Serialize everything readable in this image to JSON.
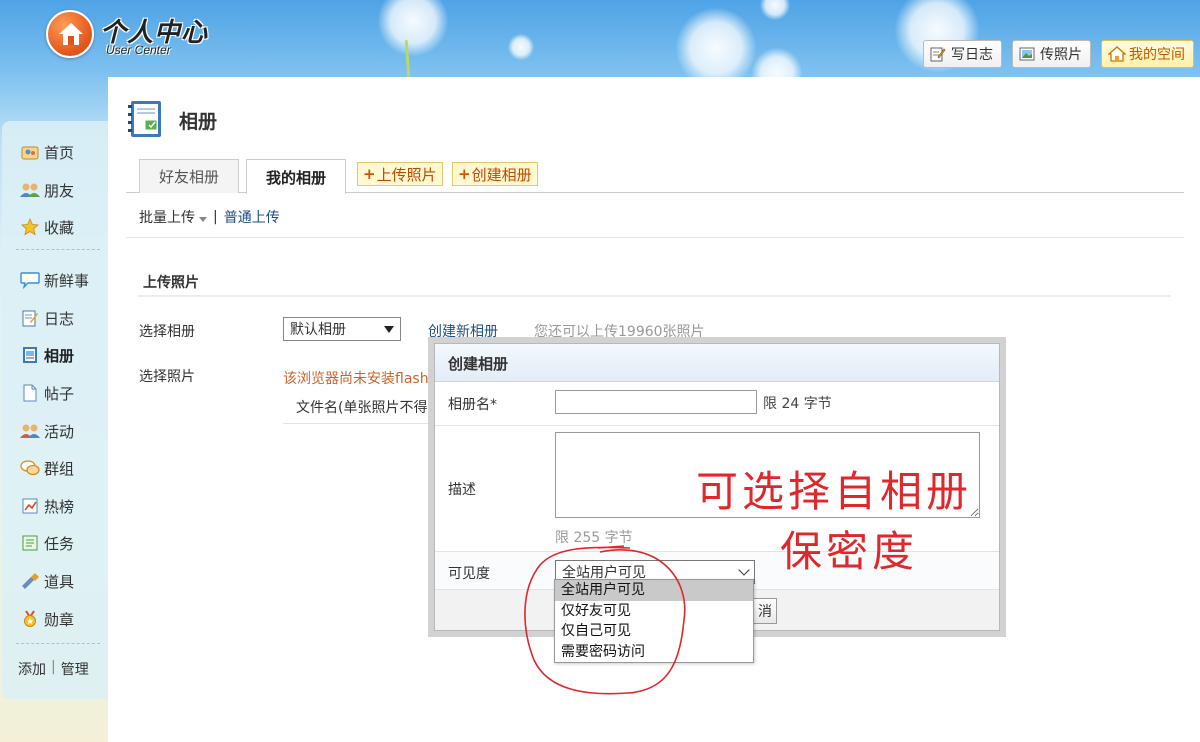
{
  "header": {
    "logo_title": "个人中心",
    "logo_subtitle": "User Center",
    "actions": [
      {
        "label": "写日志",
        "icon": "pencil-note-icon"
      },
      {
        "label": "传照片",
        "icon": "photo-icon"
      },
      {
        "label": "我的空间",
        "icon": "home-icon"
      }
    ]
  },
  "sidebar": {
    "items": [
      {
        "label": "首页",
        "icon": "home-people-icon"
      },
      {
        "label": "朋友",
        "icon": "friends-icon"
      },
      {
        "label": "收藏",
        "icon": "star-icon"
      },
      {
        "label": "新鲜事",
        "icon": "speech-bubble-icon"
      },
      {
        "label": "日志",
        "icon": "notebook-icon"
      },
      {
        "label": "相册",
        "icon": "album-icon",
        "active": true
      },
      {
        "label": "帖子",
        "icon": "document-icon"
      },
      {
        "label": "活动",
        "icon": "people-activity-icon"
      },
      {
        "label": "群组",
        "icon": "chat-group-icon"
      },
      {
        "label": "热榜",
        "icon": "hot-list-icon"
      },
      {
        "label": "任务",
        "icon": "task-icon"
      },
      {
        "label": "道具",
        "icon": "tool-icon"
      },
      {
        "label": "勋章",
        "icon": "medal-icon"
      }
    ],
    "footer_add": "添加",
    "footer_sep": "|",
    "footer_manage": "管理"
  },
  "page": {
    "title": "相册",
    "tabs": [
      {
        "label": "好友相册",
        "active": false
      },
      {
        "label": "我的相册",
        "active": true
      }
    ],
    "tab_actions": [
      {
        "plus": "+",
        "label": "上传照片"
      },
      {
        "plus": "+",
        "label": "创建相册"
      }
    ],
    "subnav": {
      "batch_upload": "批量上传",
      "sep": "|",
      "normal_upload": "普通上传"
    },
    "section_title": "上传照片",
    "select_album_label": "选择相册",
    "album_selected": "默认相册",
    "create_new_album": "创建新相册",
    "quota_text": "您还可以上传19960张照片",
    "select_photo_label": "选择照片",
    "flash_warning": "该浏览器尚未安装flash",
    "file_name_header": "文件名(单张照片不得"
  },
  "dialog": {
    "title": "创建相册",
    "name_label": "相册名*",
    "name_value": "",
    "name_limit": "限 24 字节",
    "desc_label": "描述",
    "desc_value": "",
    "desc_limit": "限 255 字节",
    "visibility_label": "可见度",
    "visibility_selected": "全站用户可见",
    "visibility_options": [
      "全站用户可见",
      "仅好友可见",
      "仅自己可见",
      "需要密码访问"
    ],
    "cancel_button_partial": "消"
  },
  "annotation": {
    "line1": "可选择自相册",
    "line2": "保密度",
    "color": "#e0272b"
  },
  "colors": {
    "link": "#1f4f82",
    "warning": "#c8652a",
    "tab_action_text": "#c04a00"
  }
}
